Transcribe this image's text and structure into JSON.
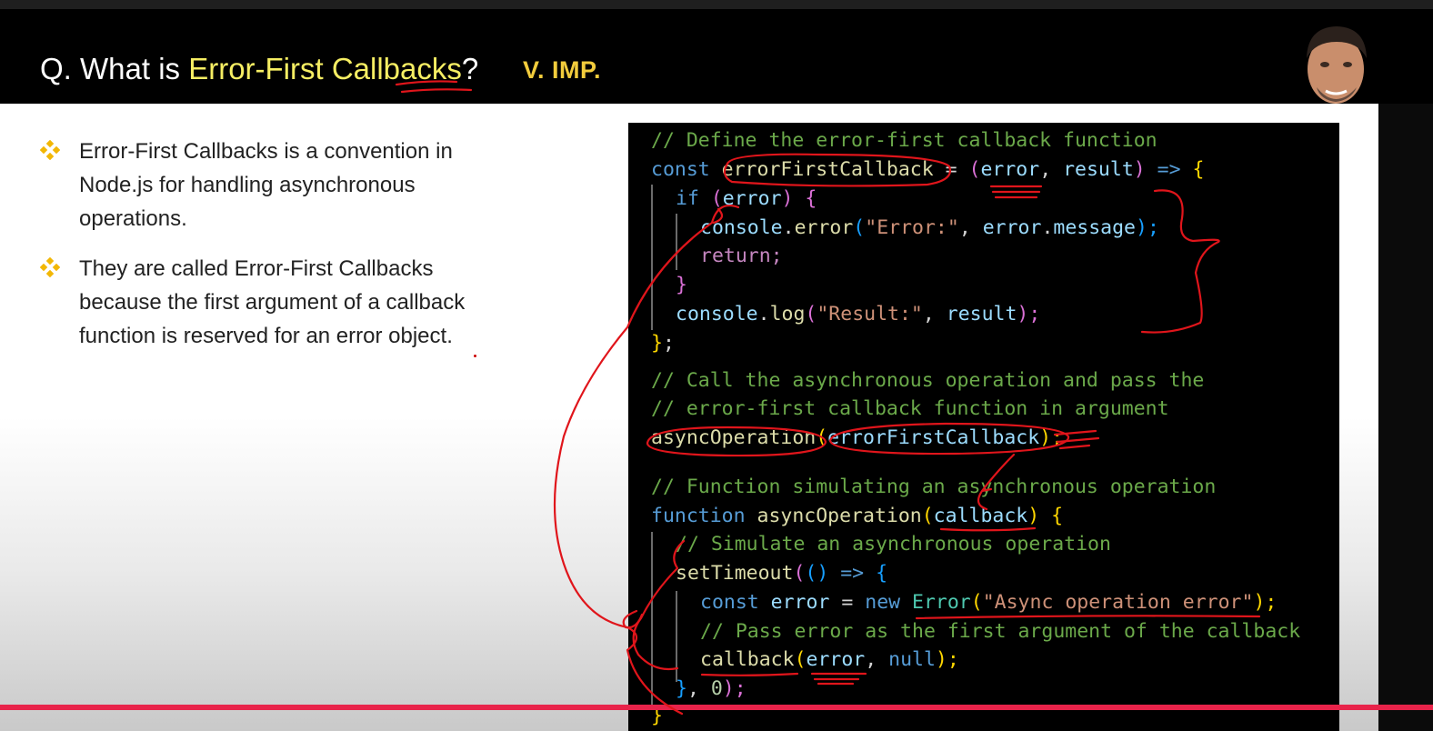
{
  "header": {
    "title_prefix": "Q. What is ",
    "title_highlight": "Error-First Callbacks",
    "title_suffix": "?",
    "importance": "V. IMP."
  },
  "bullets": [
    "Error-First Callbacks is a convention in Node.js for handling asynchronous operations.",
    "They are called Error-First Callbacks because the first argument of a callback function is reserved for an error object."
  ],
  "code": {
    "l1": "// Define the error-first callback function",
    "l2_const": "const ",
    "l2_name": "errorFirstCallback",
    "l2_eq": " = ",
    "l2_p1": "(",
    "l2_error": "error",
    "l2_comma": ", ",
    "l2_result": "result",
    "l2_p2": ")",
    "l2_arrow": " => ",
    "l2_brace": "{",
    "l3_if": "if ",
    "l3_paren": "(",
    "l3_error": "error",
    "l3_paren2": ") ",
    "l3_brace": "{",
    "l4_console": "console",
    "l4_dot": ".",
    "l4_fn": "error",
    "l4_p": "(",
    "l4_str": "\"Error:\"",
    "l4_comma": ", ",
    "l4_err": "error",
    "l4_dot2": ".",
    "l4_msg": "message",
    "l4_end": ");",
    "l5": "return;",
    "l6": "}",
    "l7_console": "console",
    "l7_dot": ".",
    "l7_fn": "log",
    "l7_p": "(",
    "l7_str": "\"Result:\"",
    "l7_comma": ", ",
    "l7_res": "result",
    "l7_end": ");",
    "l8_brace": "}",
    "l8_semi": ";",
    "l9": "// Call the asynchronous operation and pass the",
    "l10": "// error-first callback function in argument",
    "l11_fn": "asyncOperation",
    "l11_p": "(",
    "l11_arg": "errorFirstCallback",
    "l11_end": ");",
    "l12": "// Function simulating an asynchronous operation",
    "l13_kw": "function ",
    "l13_fn": "asyncOperation",
    "l13_p": "(",
    "l13_arg": "callback",
    "l13_p2": ") ",
    "l13_brace": "{",
    "l14": "// Simulate an asynchronous operation",
    "l15_fn": "setTimeout",
    "l15_p": "(",
    "l15_p2": "()",
    "l15_arrow": " => ",
    "l15_brace": "{",
    "l16_const": "const ",
    "l16_var": "error",
    "l16_eq": " = ",
    "l16_new": "new ",
    "l16_cls": "Error",
    "l16_p": "(",
    "l16_str": "\"Async operation error\"",
    "l16_end": ");",
    "l17": "// Pass error as the first argument of the callback",
    "l18_fn": "callback",
    "l18_p": "(",
    "l18_err": "error",
    "l18_comma": ", ",
    "l18_null": "null",
    "l18_end": ");",
    "l19_brace": "}",
    "l19_comma": ", ",
    "l19_zero": "0",
    "l19_end": ");",
    "l20": "}"
  }
}
